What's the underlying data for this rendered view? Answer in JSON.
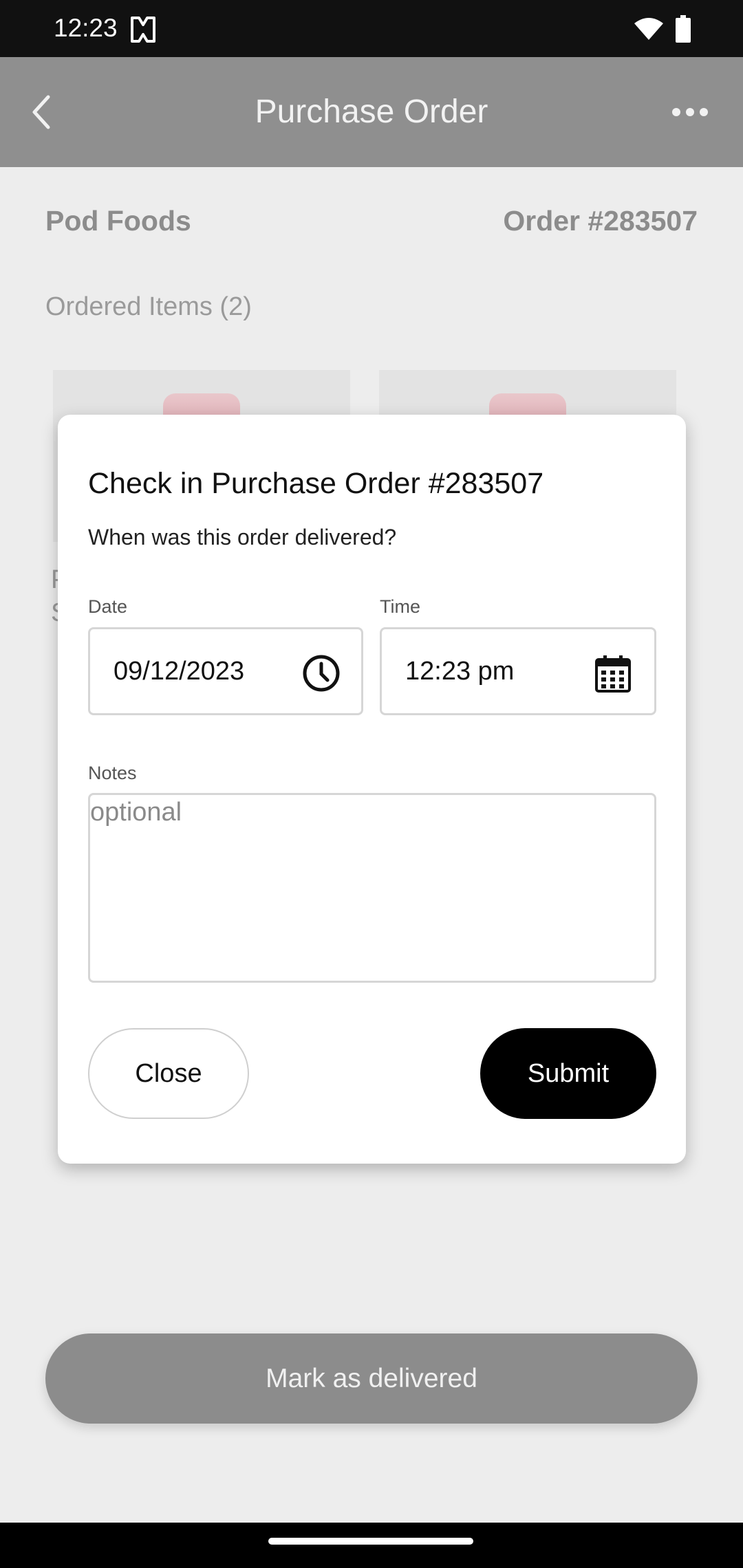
{
  "status_bar": {
    "time": "12:23"
  },
  "app_bar": {
    "title": "Purchase Order"
  },
  "summary": {
    "vendor": "Pod Foods",
    "order_number": "Order #283507",
    "ordered_items": "Ordered Items (2)"
  },
  "dialog": {
    "title": "Check in Purchase Order #283507",
    "subtitle": "When was this order delivered?",
    "date_label": "Date",
    "date_value": "09/12/2023",
    "time_label": "Time",
    "time_value": "12:23 pm",
    "notes_label": "Notes",
    "notes_placeholder": "optional",
    "close_label": "Close",
    "submit_label": "Submit"
  },
  "footer": {
    "mark_delivered_label": "Mark as delivered"
  },
  "icons": [
    "status-app-icon",
    "wifi-icon",
    "battery-icon",
    "back-icon",
    "more-icon",
    "clock-icon",
    "calendar-icon"
  ]
}
